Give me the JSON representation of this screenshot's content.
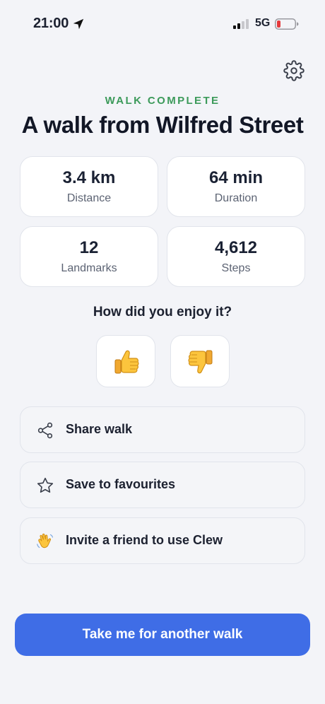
{
  "status_bar": {
    "time": "21:00",
    "network": "5G"
  },
  "header": {
    "eyebrow": "WALK COMPLETE",
    "title": "A walk from Wilfred Street"
  },
  "stats": [
    {
      "value": "3.4 km",
      "label": "Distance"
    },
    {
      "value": "64 min",
      "label": "Duration"
    },
    {
      "value": "12",
      "label": "Landmarks"
    },
    {
      "value": "4,612",
      "label": "Steps"
    }
  ],
  "feedback": {
    "question": "How did you enjoy it?"
  },
  "actions": [
    {
      "icon": "share-icon",
      "label": "Share walk"
    },
    {
      "icon": "star-icon",
      "label": "Save to favourites"
    },
    {
      "icon": "waving-hand-icon",
      "label": "Invite a friend to use Clew"
    }
  ],
  "cta": {
    "label": "Take me for another walk"
  },
  "colors": {
    "accent_green": "#3c9a5a",
    "primary_blue": "#3f6de6",
    "battery_low": "#e5393b"
  }
}
